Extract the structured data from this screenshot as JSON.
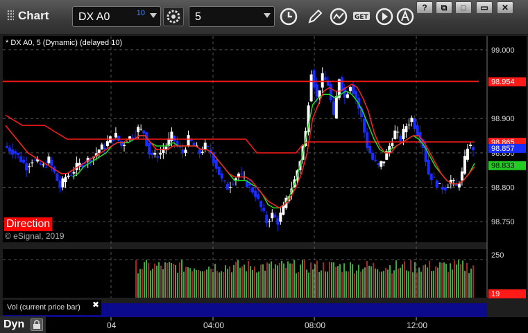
{
  "window": {
    "title": "Chart",
    "symbol": "DX A0",
    "delay_badge": "10",
    "interval": "5",
    "buttons": [
      "?",
      "⧉",
      "□",
      "✕"
    ]
  },
  "chart": {
    "legend": "* DX A0, 5 (Dynamic) (delayed 10)",
    "study_label": "Direction",
    "copyright": "© eSignal, 2019",
    "volume_pane_label": "Vol (current price bar)",
    "close_glyph": "✖",
    "footer_button": "Dyn"
  },
  "colors": {
    "up_candle": "#ffffff",
    "down_candle": "#1a2cff",
    "resistance": "#ff1a1a",
    "green_ma": "#22dd22",
    "red_ma": "#ff2222",
    "grid": "#555555"
  },
  "chart_data": {
    "type": "candlestick",
    "price_axis": {
      "min": 98.72,
      "max": 99.02,
      "ticks": [
        "99.000",
        "98.900",
        "98.850",
        "98.800",
        "98.750"
      ]
    },
    "price_tags": [
      {
        "label": "98.954",
        "value": 98.954,
        "bg": "#ff1a1a",
        "fg": "#ffffff"
      },
      {
        "label": "98.865",
        "value": 98.866,
        "bg": "#ff1a1a",
        "fg": "#ffffff"
      },
      {
        "label": "98.857",
        "value": 98.857,
        "bg": "#1a2cff",
        "fg": "#ffffff"
      },
      {
        "label": "98.833",
        "value": 98.832,
        "bg": "#22cc22",
        "fg": "#000000"
      }
    ],
    "volume_axis": {
      "max": 250,
      "ticks": [
        "250"
      ],
      "current_label": "19"
    },
    "time_ticks": [
      "04",
      "04:00",
      "08:00",
      "12:00"
    ],
    "close_path": [
      98.86,
      98.855,
      98.85,
      98.84,
      98.83,
      98.84,
      98.835,
      98.83,
      98.84,
      98.82,
      98.8,
      98.815,
      98.82,
      98.83,
      98.835,
      98.84,
      98.845,
      98.855,
      98.86,
      98.87,
      98.875,
      98.86,
      98.87,
      98.875,
      98.885,
      98.88,
      98.85,
      98.845,
      98.85,
      98.86,
      98.875,
      98.86,
      98.85,
      98.87,
      98.86,
      98.85,
      98.86,
      98.85,
      98.83,
      98.81,
      98.8,
      98.81,
      98.82,
      98.81,
      98.8,
      98.79,
      98.77,
      98.75,
      98.76,
      98.75,
      98.77,
      98.79,
      98.81,
      98.84,
      98.88,
      98.97,
      98.93,
      98.96,
      98.95,
      98.9,
      98.96,
      98.93,
      98.95,
      98.93,
      98.9,
      98.86,
      98.84,
      98.83,
      98.84,
      98.86,
      98.88,
      98.87,
      98.89,
      98.9,
      98.88,
      98.86,
      98.82,
      98.81,
      98.8,
      98.8,
      98.81,
      98.8,
      98.82,
      98.86,
      98.857
    ],
    "red_ma_path": [
      98.89,
      98.88,
      98.87,
      98.86,
      98.85,
      98.845,
      98.84,
      98.835,
      98.83,
      98.825,
      98.82,
      98.82,
      98.825,
      98.83,
      98.835,
      98.84,
      98.845,
      98.85,
      98.855,
      98.86,
      98.865,
      98.865,
      98.87,
      98.87,
      98.875,
      98.875,
      98.865,
      98.855,
      98.855,
      98.855,
      98.86,
      98.86,
      98.86,
      98.86,
      98.86,
      98.855,
      98.855,
      98.85,
      98.84,
      98.83,
      98.82,
      98.815,
      98.815,
      98.815,
      98.81,
      98.8,
      98.79,
      98.78,
      98.775,
      98.77,
      98.775,
      98.785,
      98.8,
      98.82,
      98.85,
      98.9,
      98.92,
      98.94,
      98.945,
      98.94,
      98.94,
      98.945,
      98.95,
      98.945,
      98.93,
      98.91,
      98.88,
      98.86,
      98.85,
      98.85,
      98.86,
      98.865,
      98.87,
      98.875,
      98.875,
      98.865,
      98.85,
      98.835,
      98.82,
      98.81,
      98.805,
      98.805,
      98.81,
      98.82,
      98.83
    ],
    "green_ma_path": [
      null,
      null,
      null,
      null,
      null,
      null,
      null,
      null,
      null,
      null,
      null,
      null,
      98.815,
      98.82,
      98.83,
      98.835,
      98.84,
      98.845,
      98.85,
      98.86,
      98.865,
      98.865,
      98.865,
      98.87,
      98.875,
      98.875,
      98.865,
      98.86,
      98.86,
      98.86,
      98.865,
      98.86,
      98.86,
      98.86,
      98.86,
      98.855,
      98.855,
      98.85,
      98.84,
      98.83,
      98.82,
      98.81,
      98.81,
      98.81,
      98.805,
      98.8,
      98.79,
      98.775,
      98.77,
      98.77,
      98.775,
      98.79,
      98.81,
      98.84,
      98.88,
      98.92,
      98.93,
      98.935,
      98.935,
      98.93,
      98.935,
      98.94,
      98.935,
      98.925,
      98.91,
      98.89,
      98.87,
      98.855,
      98.85,
      98.855,
      98.86,
      98.865,
      98.87,
      98.875,
      98.87,
      98.86,
      98.845,
      98.83,
      98.82,
      98.81,
      98.805,
      98.805,
      98.81,
      98.82,
      98.835
    ],
    "resistance_path": [
      98.905,
      98.9,
      98.895,
      98.89,
      98.89,
      98.89,
      98.89,
      98.89,
      98.885,
      98.88,
      98.875,
      98.87,
      98.87,
      98.87,
      98.87,
      98.87,
      98.87,
      98.87,
      98.87,
      98.87,
      98.87,
      98.87,
      98.87,
      98.87,
      98.87,
      98.87,
      98.87,
      98.87,
      98.87,
      98.87,
      98.87,
      98.87,
      98.87,
      98.87,
      98.87,
      98.87,
      98.87,
      98.87,
      98.87,
      98.87,
      98.87,
      98.87,
      98.87,
      98.87,
      98.86,
      98.85,
      98.85,
      98.85,
      98.85,
      98.85,
      98.85,
      98.85,
      98.85,
      98.86,
      98.866,
      98.866,
      98.866,
      98.866,
      98.866,
      98.866,
      98.866,
      98.866,
      98.866,
      98.866,
      98.866,
      98.866,
      98.866,
      98.866,
      98.866,
      98.866,
      98.866,
      98.866,
      98.866,
      98.866,
      98.866,
      98.866,
      98.866,
      98.866,
      98.866,
      98.866,
      98.866,
      98.866,
      98.866,
      98.866,
      98.866
    ],
    "top_line": 98.954
  }
}
